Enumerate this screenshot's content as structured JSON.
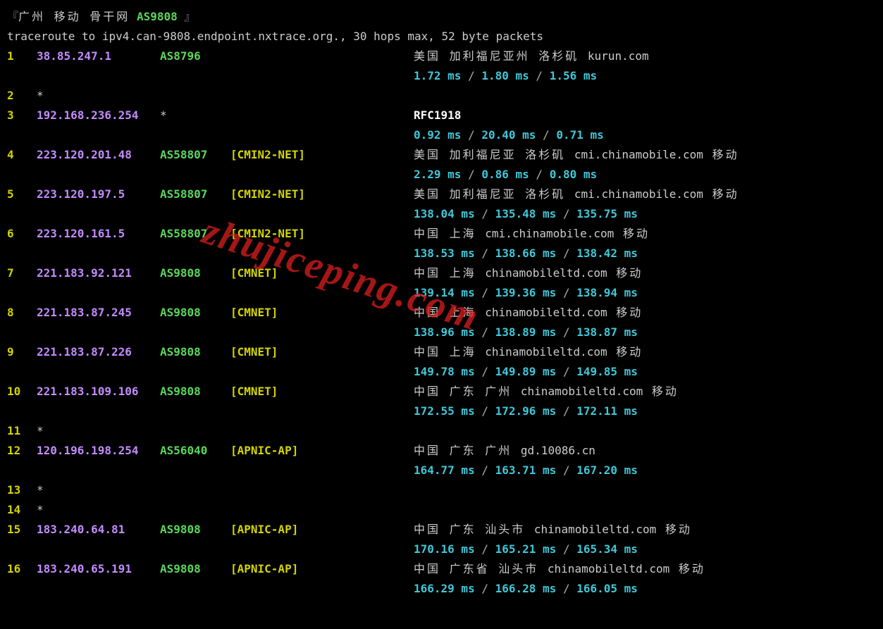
{
  "title": {
    "open": "『",
    "text": "广州 移动 骨干网",
    "asn": "AS9808",
    "close": "』"
  },
  "subtitle": "traceroute to ipv4.can-9808.endpoint.nxtrace.org., 30 hops max, 52 byte packets",
  "watermark": "zhujiceping.com",
  "hops": [
    {
      "n": "1",
      "ip": "38.85.247.1",
      "asn": "AS8796",
      "net": "",
      "loc": "美国 加利福尼亚州 洛杉矶",
      "domain": "kurun.com",
      "isp": "",
      "rfc": "",
      "t": [
        "1.72 ms",
        "1.80 ms",
        "1.56 ms"
      ]
    },
    {
      "n": "2",
      "ip": "*",
      "asn": "",
      "net": "",
      "loc": "",
      "domain": "",
      "isp": "",
      "rfc": "",
      "t": []
    },
    {
      "n": "3",
      "ip": "192.168.236.254",
      "asn": "*",
      "asn_plain": true,
      "net": "",
      "loc": "",
      "domain": "",
      "isp": "",
      "rfc": "RFC1918",
      "t": [
        "0.92 ms",
        "20.40 ms",
        "0.71 ms"
      ]
    },
    {
      "n": "4",
      "ip": "223.120.201.48",
      "asn": "AS58807",
      "net": "[CMIN2-NET]",
      "loc": "美国 加利福尼亚 洛杉矶",
      "domain": "cmi.chinamobile.com",
      "isp": "移动",
      "rfc": "",
      "t": [
        "2.29 ms",
        "0.86 ms",
        "0.80 ms"
      ]
    },
    {
      "n": "5",
      "ip": "223.120.197.5",
      "asn": "AS58807",
      "net": "[CMIN2-NET]",
      "loc": "美国 加利福尼亚 洛杉矶",
      "domain": "cmi.chinamobile.com",
      "isp": "移动",
      "rfc": "",
      "t": [
        "138.04 ms",
        "135.48 ms",
        "135.75 ms"
      ]
    },
    {
      "n": "6",
      "ip": "223.120.161.5",
      "asn": "AS58807",
      "net": "[CMIN2-NET]",
      "loc": "中国 上海",
      "domain": "cmi.chinamobile.com",
      "isp": "移动",
      "rfc": "",
      "t": [
        "138.53 ms",
        "138.66 ms",
        "138.42 ms"
      ]
    },
    {
      "n": "7",
      "ip": "221.183.92.121",
      "asn": "AS9808",
      "net": "[CMNET]",
      "loc": "中国 上海",
      "domain": "chinamobileltd.com",
      "isp": "移动",
      "rfc": "",
      "t": [
        "139.14 ms",
        "139.36 ms",
        "138.94 ms"
      ]
    },
    {
      "n": "8",
      "ip": "221.183.87.245",
      "asn": "AS9808",
      "net": "[CMNET]",
      "loc": "中国 上海",
      "domain": "chinamobileltd.com",
      "isp": "移动",
      "rfc": "",
      "t": [
        "138.96 ms",
        "138.89 ms",
        "138.87 ms"
      ]
    },
    {
      "n": "9",
      "ip": "221.183.87.226",
      "asn": "AS9808",
      "net": "[CMNET]",
      "loc": "中国 上海",
      "domain": "chinamobileltd.com",
      "isp": "移动",
      "rfc": "",
      "t": [
        "149.78 ms",
        "149.89 ms",
        "149.85 ms"
      ]
    },
    {
      "n": "10",
      "ip": "221.183.109.106",
      "asn": "AS9808",
      "net": "[CMNET]",
      "loc": "中国 广东 广州",
      "domain": "chinamobileltd.com",
      "isp": "移动",
      "rfc": "",
      "t": [
        "172.55 ms",
        "172.96 ms",
        "172.11 ms"
      ]
    },
    {
      "n": "11",
      "ip": "*",
      "asn": "",
      "net": "",
      "loc": "",
      "domain": "",
      "isp": "",
      "rfc": "",
      "t": []
    },
    {
      "n": "12",
      "ip": "120.196.198.254",
      "asn": "AS56040",
      "net": "[APNIC-AP]",
      "loc": "中国 广东 广州",
      "domain": "gd.10086.cn",
      "isp": "",
      "rfc": "",
      "t": [
        "164.77 ms",
        "163.71 ms",
        "167.20 ms"
      ]
    },
    {
      "n": "13",
      "ip": "*",
      "asn": "",
      "net": "",
      "loc": "",
      "domain": "",
      "isp": "",
      "rfc": "",
      "t": []
    },
    {
      "n": "14",
      "ip": "*",
      "asn": "",
      "net": "",
      "loc": "",
      "domain": "",
      "isp": "",
      "rfc": "",
      "t": []
    },
    {
      "n": "15",
      "ip": "183.240.64.81",
      "asn": "AS9808",
      "net": "[APNIC-AP]",
      "loc": "中国 广东 汕头市",
      "domain": "chinamobileltd.com",
      "isp": "移动",
      "rfc": "",
      "t": [
        "170.16 ms",
        "165.21 ms",
        "165.34 ms"
      ]
    },
    {
      "n": "16",
      "ip": "183.240.65.191",
      "asn": "AS9808",
      "net": "[APNIC-AP]",
      "loc": "中国 广东省 汕头市",
      "domain": "chinamobileltd.com",
      "isp": "移动",
      "rfc": "",
      "t": [
        "166.29 ms",
        "166.28 ms",
        "166.05 ms"
      ]
    }
  ]
}
